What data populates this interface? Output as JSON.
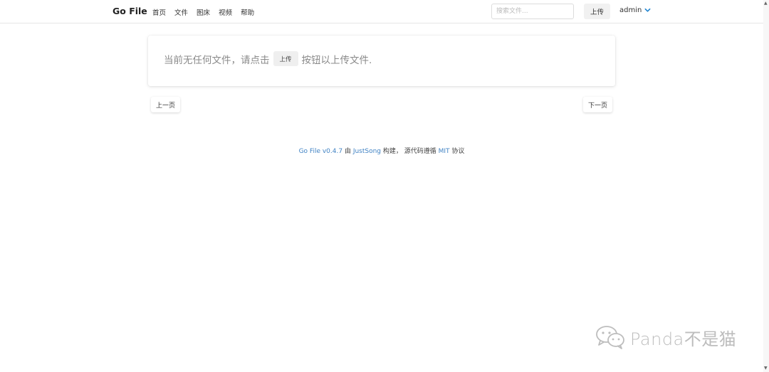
{
  "header": {
    "brand": "Go File",
    "nav": [
      "首页",
      "文件",
      "图床",
      "视频",
      "帮助"
    ],
    "search_placeholder": "搜索文件...",
    "upload_label": "上传",
    "user_label": "admin"
  },
  "main": {
    "empty_prefix": "当前无任何文件，请点击",
    "empty_button": "上传",
    "empty_suffix": "按钮以上传文件."
  },
  "pagination": {
    "prev": "上一页",
    "next": "下一页"
  },
  "footer": {
    "app": "Go File v0.4.7",
    "by": " 由 ",
    "author": "JustSong",
    "built": " 构建， 源代码遵循 ",
    "license": "MIT",
    "agreement": " 协议"
  },
  "watermark": "Panda不是猫",
  "colors": {
    "link": "#4183c4",
    "accent": "#2185d0"
  }
}
